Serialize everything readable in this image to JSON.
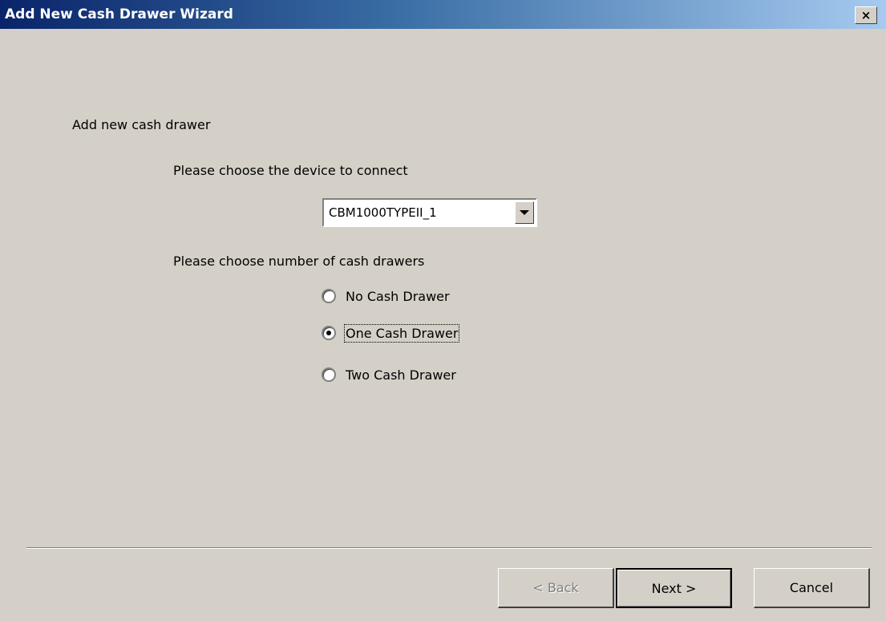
{
  "window": {
    "title": "Add New Cash Drawer Wizard",
    "close_glyph": "×"
  },
  "page": {
    "heading": "Add new cash drawer",
    "device_label": "Please choose the device to connect",
    "device_select": {
      "value": "CBM1000TYPEII_1"
    },
    "drawers_label": "Please choose number of cash drawers",
    "options": [
      {
        "label": "No Cash Drawer",
        "checked": false
      },
      {
        "label": "One Cash Drawer",
        "checked": true
      },
      {
        "label": "Two Cash Drawer",
        "checked": false
      }
    ]
  },
  "buttons": {
    "back": "< Back",
    "next": "Next >",
    "cancel": "Cancel"
  }
}
